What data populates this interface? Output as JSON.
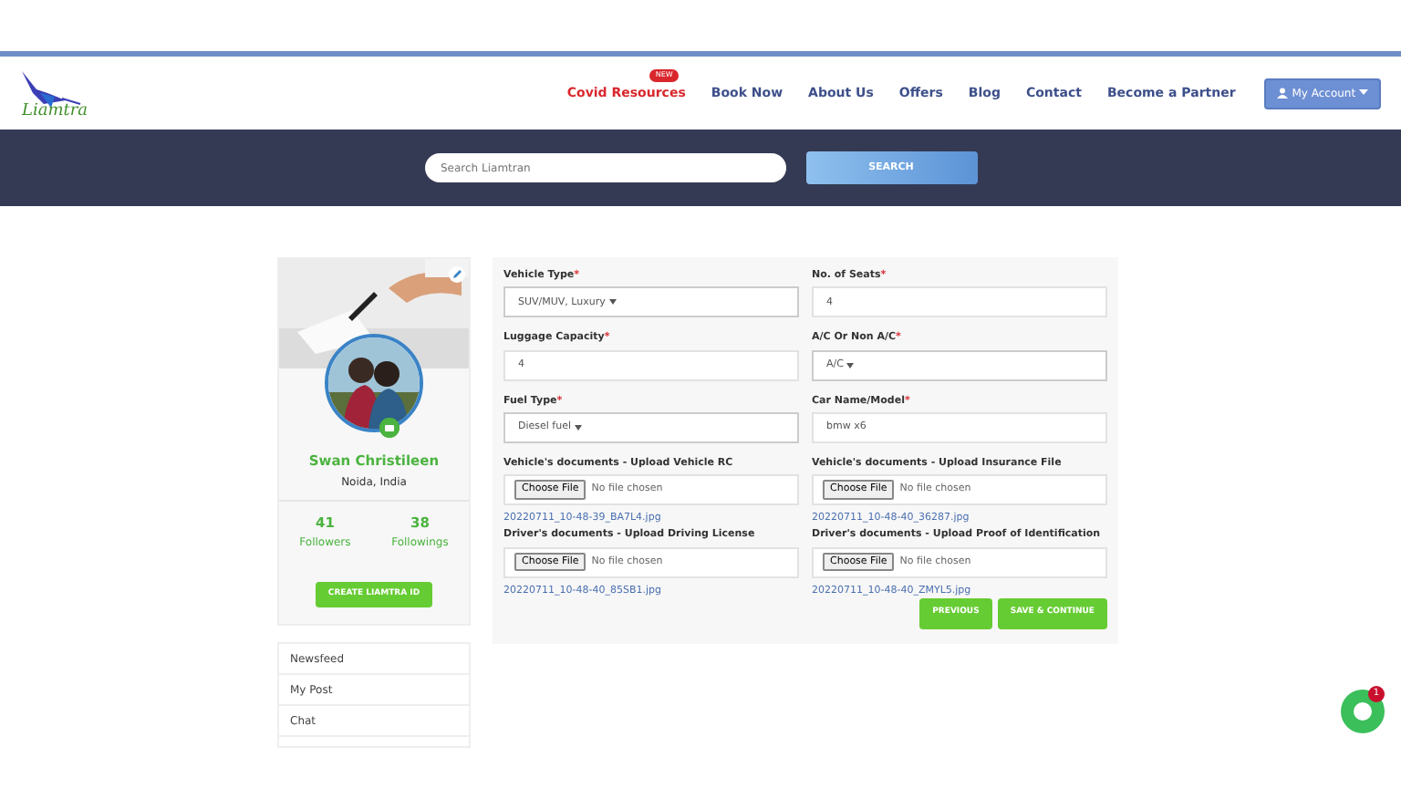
{
  "logo": {
    "text": "Liamtra"
  },
  "nav": [
    {
      "label": "Covid Resources",
      "kind": "highlight",
      "badge": "NEW"
    },
    {
      "label": "Book Now",
      "kind": "link"
    },
    {
      "label": "About Us",
      "kind": "link"
    },
    {
      "label": "Offers",
      "kind": "link"
    },
    {
      "label": "Blog",
      "kind": "link"
    },
    {
      "label": "Contact",
      "kind": "link"
    },
    {
      "label": "Become a Partner",
      "kind": "link"
    }
  ],
  "account_button": {
    "label": "My Account"
  },
  "search": {
    "placeholder": "Search Liamtran",
    "button": "SEARCH"
  },
  "profile": {
    "name": "Swan Christileen",
    "location": "Noida, India",
    "stats": [
      {
        "value": "41",
        "label": "Followers"
      },
      {
        "value": "38",
        "label": "Followings"
      }
    ],
    "button": "CREATE LIAMTRA ID"
  },
  "menu": [
    {
      "label": "Newsfeed"
    },
    {
      "label": "My Post"
    },
    {
      "label": "Chat"
    }
  ],
  "form": {
    "columns": [
      [
        {
          "kind": "select",
          "label": "Vehicle Type",
          "required": true,
          "value": "SUV/MUV, Luxury"
        },
        {
          "kind": "input",
          "label": "Luggage Capacity",
          "required": true,
          "value": "4"
        },
        {
          "kind": "select",
          "label": "Fuel Type",
          "required": true,
          "value": "Diesel fuel"
        },
        {
          "kind": "file",
          "label": "Vehicle's documents - Upload Vehicle RC",
          "required": false,
          "button": "Choose File",
          "status": "No file chosen",
          "link": "20220711_10-48-39_BA7L4.jpg"
        },
        {
          "kind": "file",
          "label": "Driver's documents - Upload Driving License",
          "required": false,
          "button": "Choose File",
          "status": "No file chosen",
          "link": "20220711_10-48-40_85SB1.jpg"
        }
      ],
      [
        {
          "kind": "input",
          "label": "No. of Seats",
          "required": true,
          "value": "4"
        },
        {
          "kind": "select",
          "label": "A/C Or Non A/C",
          "required": true,
          "value": "A/C"
        },
        {
          "kind": "input",
          "label": "Car Name/Model",
          "required": true,
          "value": "bmw x6"
        },
        {
          "kind": "file",
          "label": "Vehicle's documents - Upload Insurance File",
          "required": false,
          "button": "Choose File",
          "status": "No file chosen",
          "link": "20220711_10-48-40_36287.jpg"
        },
        {
          "kind": "file",
          "label": "Driver's documents - Upload Proof of Identification",
          "required": false,
          "button": "Choose File",
          "status": "No file chosen",
          "link": "20220711_10-48-40_ZMYL5.jpg"
        }
      ]
    ],
    "required_mark": "*",
    "buttons": [
      "PREVIOUS",
      "SAVE & CONTINUE"
    ]
  },
  "chat": {
    "badge": "1"
  }
}
